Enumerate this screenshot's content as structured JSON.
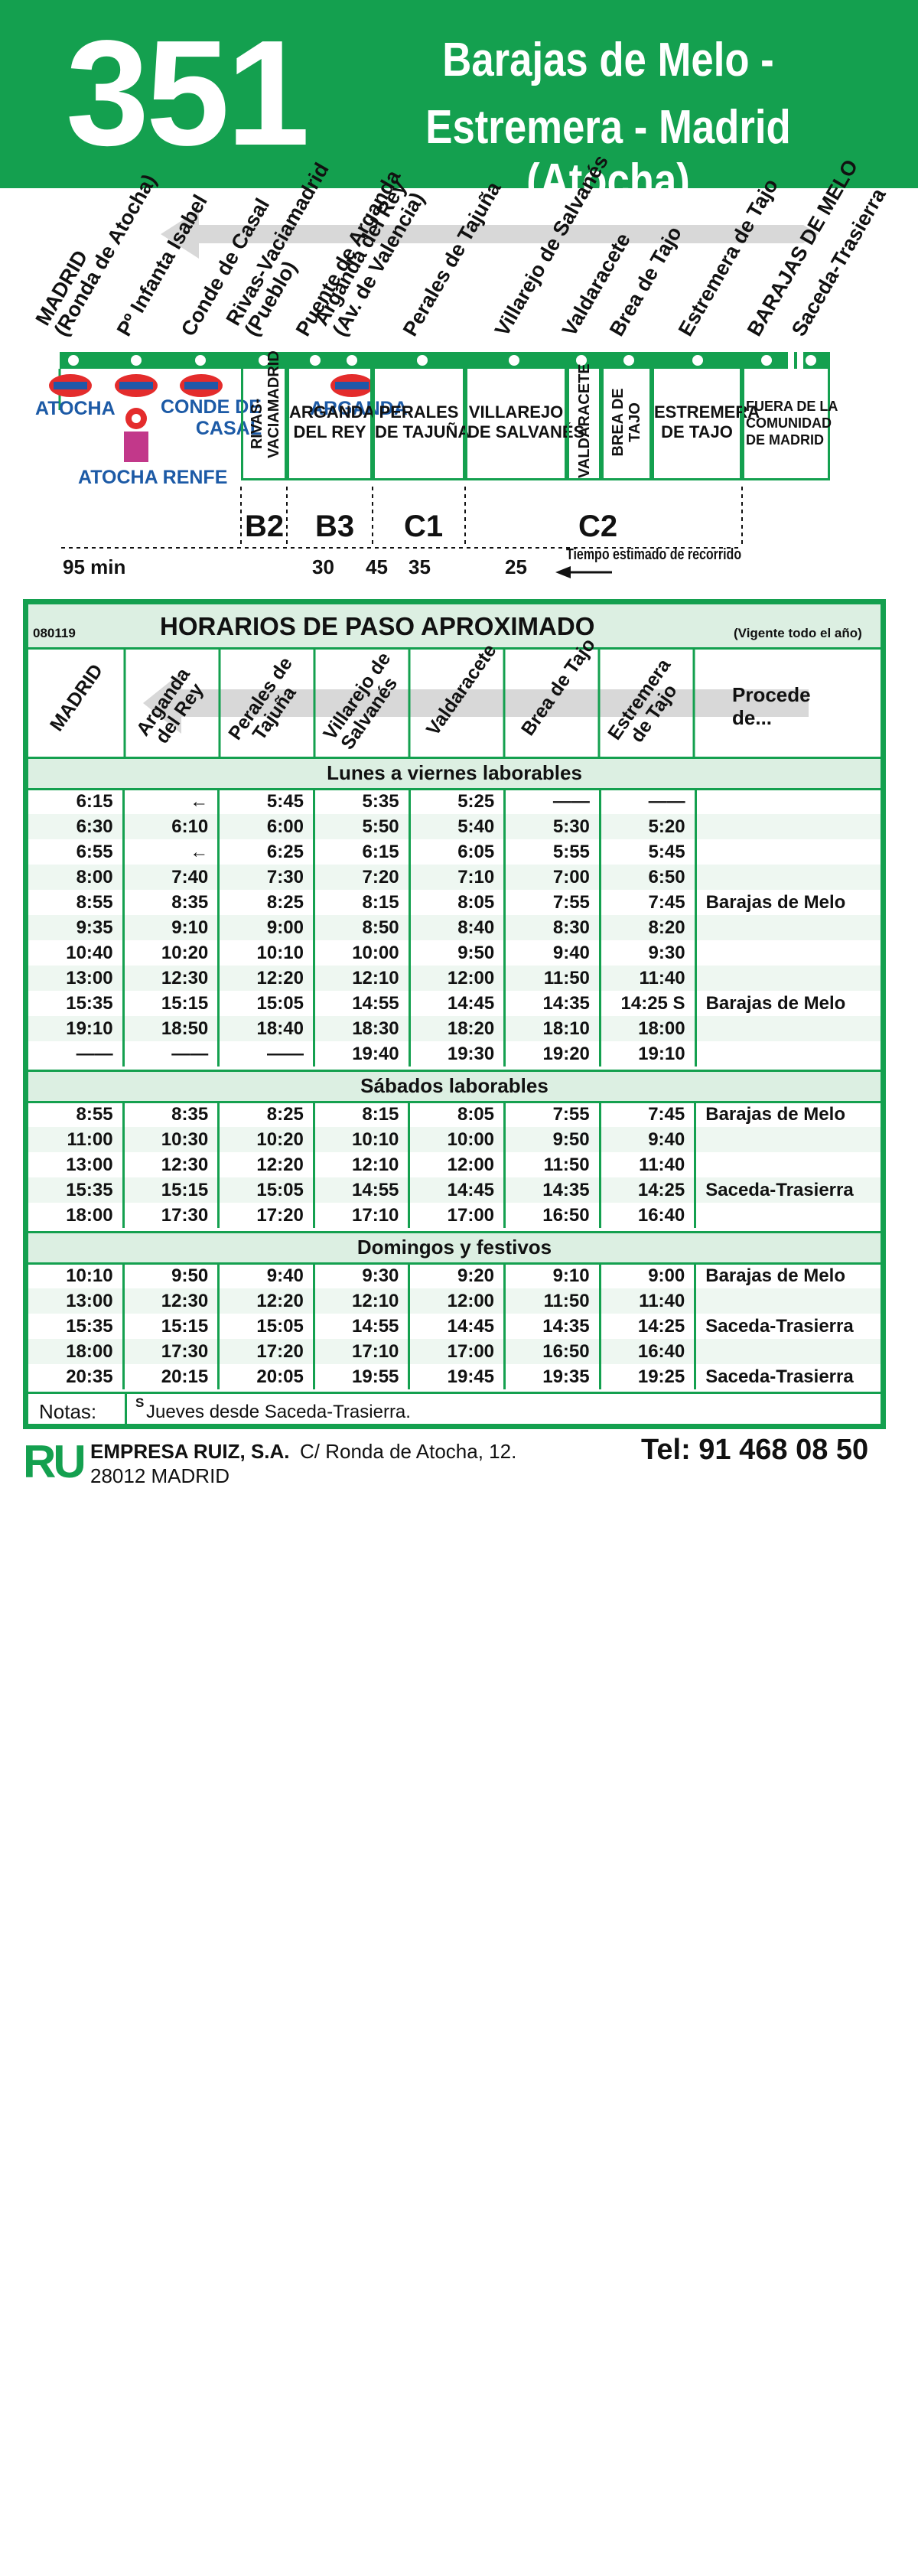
{
  "header": {
    "route_number": "351",
    "route_name_1": "Barajas de Melo -",
    "route_name_2": "Estremera - Madrid (Atocha)",
    "bg": "#14a04f"
  },
  "stops": [
    "MADRID\n(Ronda de Atocha)",
    "Pº Infanta Isabel",
    "Conde de Casal",
    "Rivas-Vaciamadrid\n(Pueblo)",
    "Puente de Arganda",
    "Arganda del Rey\n(Av. de Valencia)",
    "Perales de Tajuña",
    "Villarejo de Salvanés",
    "Valdaracete",
    "Brea de Tajo",
    "Estremera de Tajo",
    "BARAJAS DE MELO",
    "Saceda-Trasierra"
  ],
  "connections": {
    "atocha": "ATOCHA",
    "conde_casal": "CONDE DE\nCASAL",
    "arganda": "ARGANDA",
    "atocha_renfe": "ATOCHA RENFE"
  },
  "towns": [
    "RIVAS-\nVACIAMADRID",
    "ARGANDA\nDEL REY",
    "PERALES\nDE TAJUÑA",
    "VILLAREJO\nDE SALVANÉS",
    "VALDARACETE",
    "BREA DE\nTAJO",
    "ESTREMERA\nDE TAJO",
    "FUERA DE LA\nCOMUNIDAD\nDE MADRID"
  ],
  "zones": [
    "B2",
    "B3",
    "C1",
    "C2"
  ],
  "travel_times": {
    "t1": "95 min",
    "t2": "30",
    "t3": "45",
    "t4": "35",
    "t5": "25",
    "label": "Tiempo estimado de recorrido"
  },
  "schedule": {
    "code": "080119",
    "title": "HORARIOS DE PASO APROXIMADO",
    "validity": "(Vigente todo el año)",
    "columns": [
      "MADRID",
      "Arganda\ndel Rey",
      "Perales de\nTajuña",
      "Villarejo de\nSalvanés",
      "Valdaracete",
      "Brea de Tajo",
      "Estremera\nde Tajo"
    ],
    "origin_header": "Procede\nde...",
    "sections": [
      {
        "label": "Lunes a viernes laborables",
        "rows": [
          [
            "6:15",
            "←",
            "5:45",
            "5:35",
            "5:25",
            "——",
            "——",
            ""
          ],
          [
            "6:30",
            "6:10",
            "6:00",
            "5:50",
            "5:40",
            "5:30",
            "5:20",
            ""
          ],
          [
            "6:55",
            "←",
            "6:25",
            "6:15",
            "6:05",
            "5:55",
            "5:45",
            ""
          ],
          [
            "8:00",
            "7:40",
            "7:30",
            "7:20",
            "7:10",
            "7:00",
            "6:50",
            ""
          ],
          [
            "8:55",
            "8:35",
            "8:25",
            "8:15",
            "8:05",
            "7:55",
            "7:45",
            "Barajas de Melo"
          ],
          [
            "9:35",
            "9:10",
            "9:00",
            "8:50",
            "8:40",
            "8:30",
            "8:20",
            ""
          ],
          [
            "10:40",
            "10:20",
            "10:10",
            "10:00",
            "9:50",
            "9:40",
            "9:30",
            ""
          ],
          [
            "13:00",
            "12:30",
            "12:20",
            "12:10",
            "12:00",
            "11:50",
            "11:40",
            ""
          ],
          [
            "15:35",
            "15:15",
            "15:05",
            "14:55",
            "14:45",
            "14:35",
            "14:25 S",
            "Barajas de Melo"
          ],
          [
            "19:10",
            "18:50",
            "18:40",
            "18:30",
            "18:20",
            "18:10",
            "18:00",
            ""
          ],
          [
            "——",
            "——",
            "——",
            "19:40",
            "19:30",
            "19:20",
            "19:10",
            ""
          ]
        ]
      },
      {
        "label": "Sábados laborables",
        "rows": [
          [
            "8:55",
            "8:35",
            "8:25",
            "8:15",
            "8:05",
            "7:55",
            "7:45",
            "Barajas de Melo"
          ],
          [
            "11:00",
            "10:30",
            "10:20",
            "10:10",
            "10:00",
            "9:50",
            "9:40",
            ""
          ],
          [
            "13:00",
            "12:30",
            "12:20",
            "12:10",
            "12:00",
            "11:50",
            "11:40",
            ""
          ],
          [
            "15:35",
            "15:15",
            "15:05",
            "14:55",
            "14:45",
            "14:35",
            "14:25",
            "Saceda-Trasierra"
          ],
          [
            "18:00",
            "17:30",
            "17:20",
            "17:10",
            "17:00",
            "16:50",
            "16:40",
            ""
          ]
        ]
      },
      {
        "label": "Domingos y festivos",
        "rows": [
          [
            "10:10",
            "9:50",
            "9:40",
            "9:30",
            "9:20",
            "9:10",
            "9:00",
            "Barajas de Melo"
          ],
          [
            "13:00",
            "12:30",
            "12:20",
            "12:10",
            "12:00",
            "11:50",
            "11:40",
            ""
          ],
          [
            "15:35",
            "15:15",
            "15:05",
            "14:55",
            "14:45",
            "14:35",
            "14:25",
            "Saceda-Trasierra"
          ],
          [
            "18:00",
            "17:30",
            "17:20",
            "17:10",
            "17:00",
            "16:50",
            "16:40",
            ""
          ],
          [
            "20:35",
            "20:15",
            "20:05",
            "19:55",
            "19:45",
            "19:35",
            "19:25",
            "Saceda-Trasierra"
          ]
        ]
      }
    ],
    "notes_label": "Notas:",
    "notes_sup": "S",
    "notes_text": "Jueves desde Saceda-Trasierra."
  },
  "footer": {
    "logo": "RU",
    "company": "EMPRESA RUIZ, S.A.",
    "address": "C/ Ronda de Atocha, 12.",
    "city": "28012 MADRID",
    "phone": "Tel: 91 468 08 50"
  }
}
